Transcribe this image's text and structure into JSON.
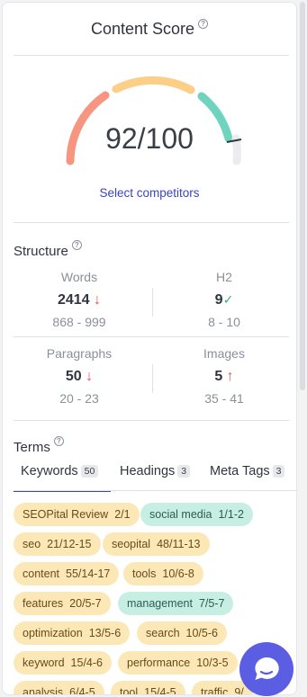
{
  "content_score": {
    "title": "Content Score",
    "help_icon": "help-circle-icon",
    "score_text": "92/100",
    "score_value": 92,
    "score_max": 100,
    "select_competitors_label": "Select competitors",
    "gauge_colors": {
      "low": "#f69580",
      "mid": "#fbcf88",
      "high": "#6fd4be"
    }
  },
  "structure": {
    "title": "Structure",
    "metrics": [
      {
        "label": "Words",
        "value": "2414",
        "trend": "↓",
        "range": "868 - 999"
      },
      {
        "label": "H2",
        "value": "9",
        "trend": "✓",
        "range": "8 - 10"
      },
      {
        "label": "Paragraphs",
        "value": "50",
        "trend": "↓",
        "range": "20 - 23"
      },
      {
        "label": "Images",
        "value": "5",
        "trend": "↑",
        "range": "35 - 41"
      }
    ]
  },
  "terms": {
    "title": "Terms",
    "tabs": [
      {
        "label": "Keywords",
        "count": "50",
        "active": true
      },
      {
        "label": "Headings",
        "count": "3",
        "active": false
      },
      {
        "label": "Meta Tags",
        "count": "3",
        "active": false
      }
    ],
    "chips": [
      {
        "term": "SEOPital Review",
        "count": "2/1",
        "color": "yellow"
      },
      {
        "term": "social media",
        "count": "1/1-2",
        "color": "green"
      },
      {
        "term": "seo",
        "count": "21/12-15",
        "color": "yellow"
      },
      {
        "term": "seopital",
        "count": "48/11-13",
        "color": "yellow"
      },
      {
        "term": "content",
        "count": "55/14-17",
        "color": "yellow"
      },
      {
        "term": "tools",
        "count": "10/6-8",
        "color": "yellow"
      },
      {
        "term": "features",
        "count": "20/5-7",
        "color": "yellow"
      },
      {
        "term": "management",
        "count": "7/5-7",
        "color": "green"
      },
      {
        "term": "optimization",
        "count": "13/5-6",
        "color": "yellow"
      },
      {
        "term": "search",
        "count": "10/5-6",
        "color": "yellow"
      },
      {
        "term": "keyword",
        "count": "15/4-6",
        "color": "yellow"
      },
      {
        "term": "performance",
        "count": "10/3-5",
        "color": "yellow"
      },
      {
        "term": "analysis",
        "count": "6/4-5",
        "color": "yellow"
      },
      {
        "term": "tool",
        "count": "15/4-5",
        "color": "yellow"
      },
      {
        "term": "traffic",
        "count": "9/",
        "color": "yellow"
      }
    ]
  },
  "chat_widget": {
    "icon": "chat-bubble-icon"
  }
}
